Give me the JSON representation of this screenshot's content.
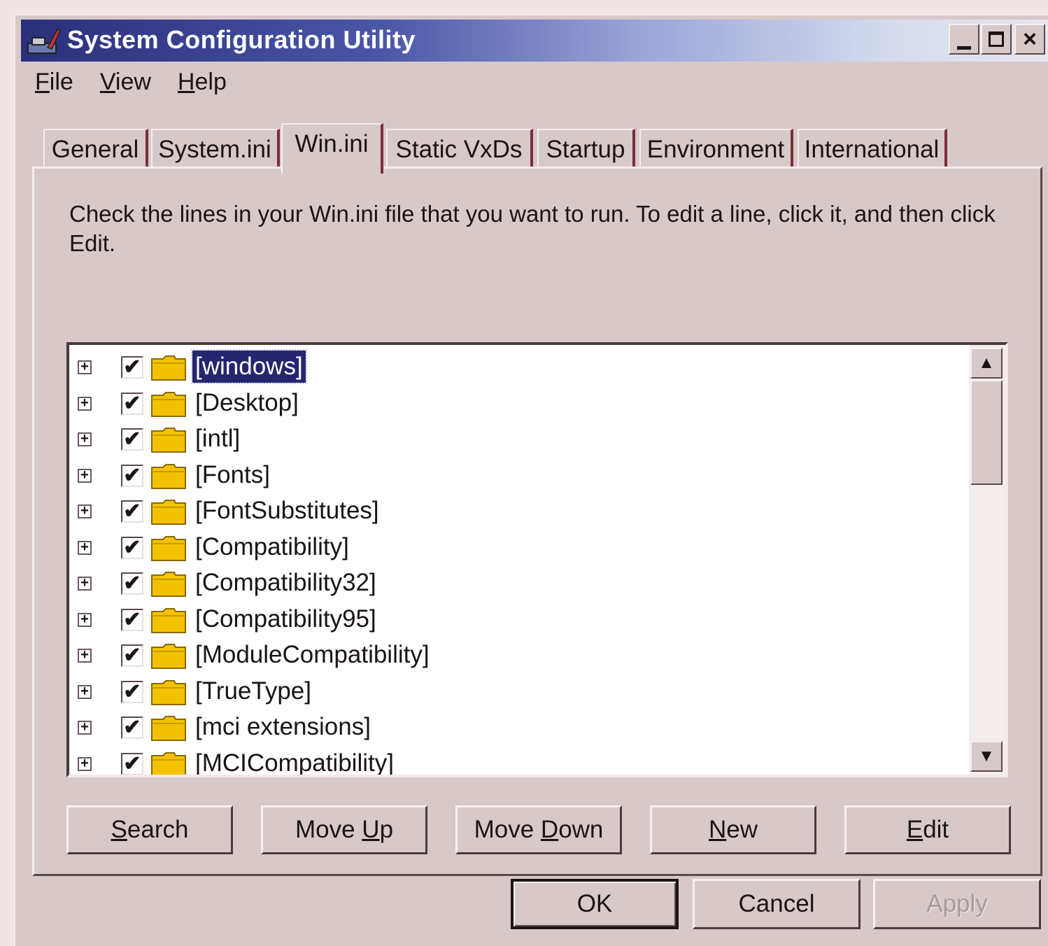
{
  "window": {
    "title": "System Configuration Utility",
    "controls": {
      "minimize": "_",
      "maximize": "□",
      "close": "×"
    }
  },
  "menu": [
    {
      "u": "F",
      "rest": "ile"
    },
    {
      "u": "V",
      "rest": "iew"
    },
    {
      "u": "H",
      "rest": "elp"
    }
  ],
  "tabs": [
    "General",
    "System.ini",
    "Win.ini",
    "Static VxDs",
    "Startup",
    "Environment",
    "International"
  ],
  "active_tab": "Win.ini",
  "description": "Check the lines in your Win.ini file that you want to run. To edit a line, click it, and then click Edit.",
  "tree_items": [
    {
      "label": "[windows]",
      "checked": true,
      "selected": true
    },
    {
      "label": "[Desktop]",
      "checked": true
    },
    {
      "label": "[intl]",
      "checked": true
    },
    {
      "label": "[Fonts]",
      "checked": true
    },
    {
      "label": "[FontSubstitutes]",
      "checked": true
    },
    {
      "label": "[Compatibility]",
      "checked": true
    },
    {
      "label": "[Compatibility32]",
      "checked": true
    },
    {
      "label": "[Compatibility95]",
      "checked": true
    },
    {
      "label": "[ModuleCompatibility]",
      "checked": true
    },
    {
      "label": "[TrueType]",
      "checked": true
    },
    {
      "label": "[mci extensions]",
      "checked": true
    },
    {
      "label": "[MCICompatibility]",
      "checked": true
    }
  ],
  "icons": {
    "expand": "plus-box-icon",
    "check": "✔",
    "folder": "folder-icon"
  },
  "panel_buttons": {
    "search": {
      "pre": "",
      "u": "S",
      "post": "earch"
    },
    "move_up": {
      "pre": "Move ",
      "u": "U",
      "post": "p"
    },
    "move_down": {
      "pre": "Move ",
      "u": "D",
      "post": "own"
    },
    "new": {
      "pre": "",
      "u": "N",
      "post": "ew"
    },
    "edit": {
      "pre": "",
      "u": "E",
      "post": "dit"
    }
  },
  "dialog_buttons": {
    "ok": "OK",
    "cancel": "Cancel",
    "apply": "Apply"
  },
  "colors": {
    "selection": "#26266e",
    "face": "#d8c9c9",
    "tab_accent": "#7a2f3a"
  }
}
